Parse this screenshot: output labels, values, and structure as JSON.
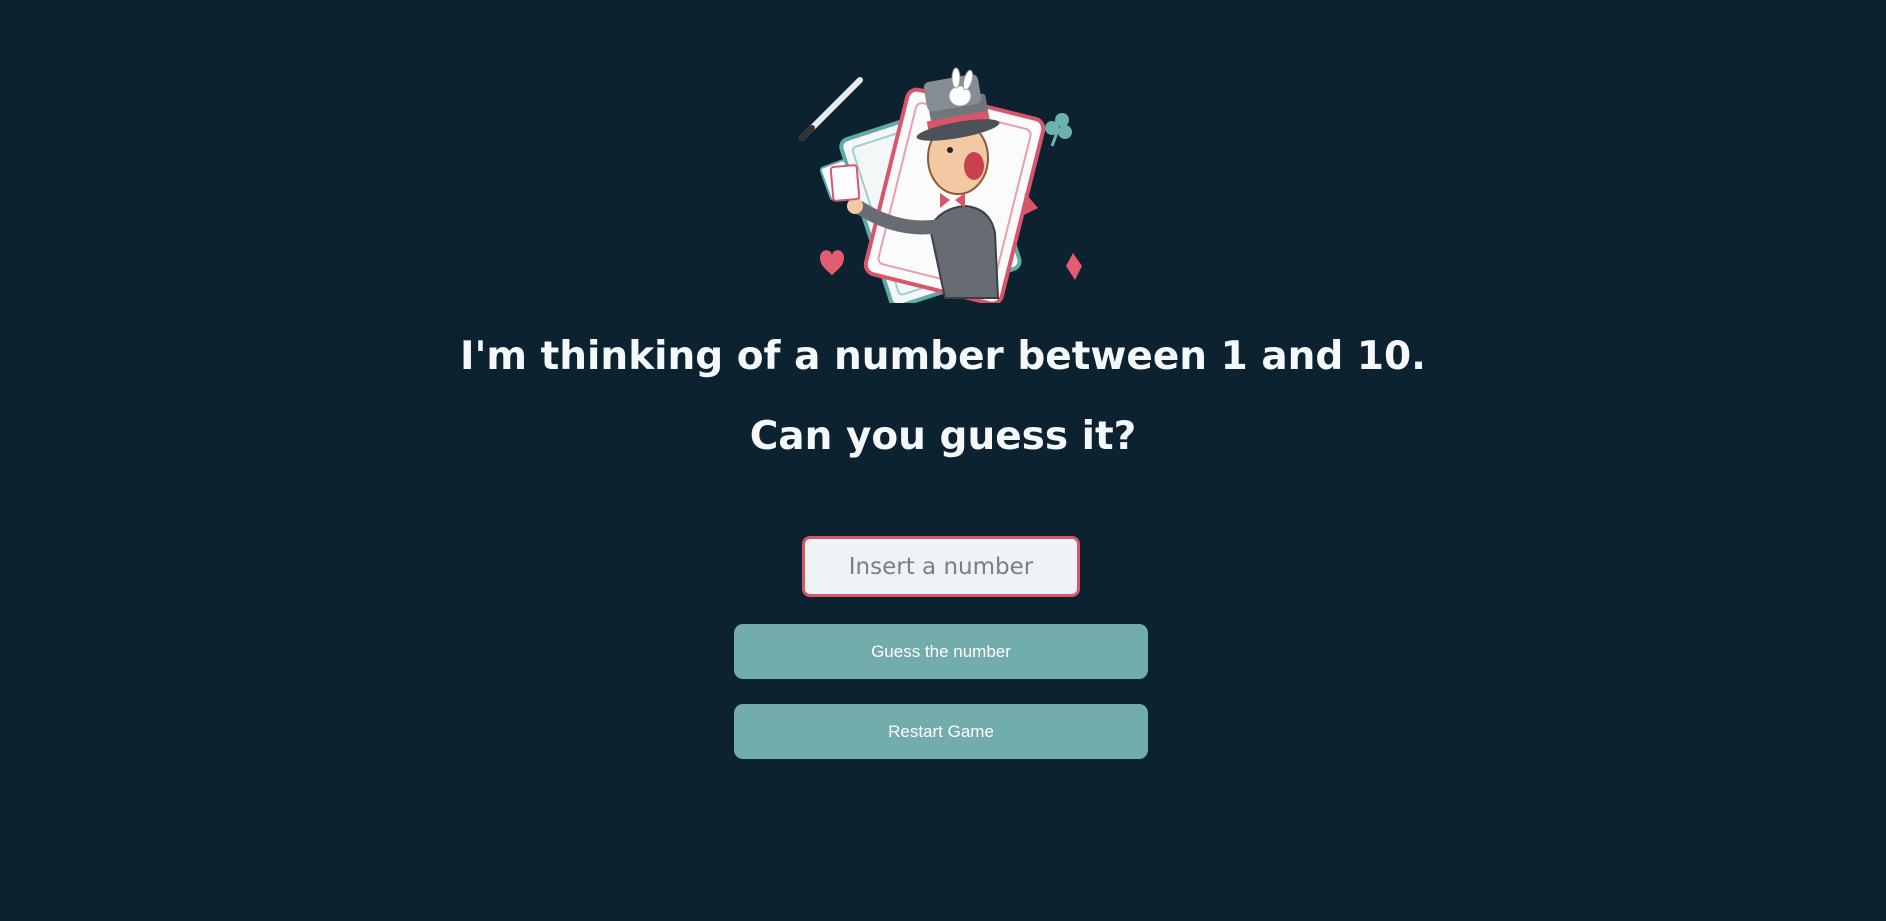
{
  "game": {
    "title_line": "I'm thinking of a number between 1 and 10.",
    "subtitle_line": "Can you guess it?",
    "input": {
      "placeholder": "Insert a number",
      "value": ""
    },
    "guess_button_label": "Guess the number",
    "restart_button_label": "Restart Game"
  },
  "colors": {
    "background": "#0c2230",
    "accent_button": "#72adac",
    "input_border": "#d9556c",
    "text": "#f4f8fb"
  },
  "illustration": {
    "icon": "magician-with-cards-icon"
  }
}
